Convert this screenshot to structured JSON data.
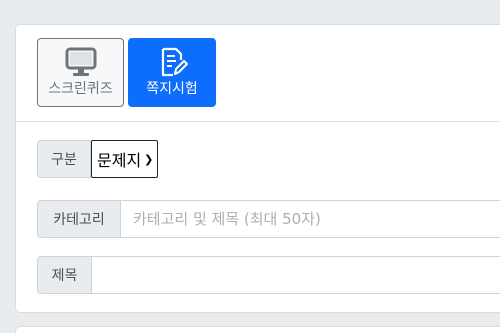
{
  "mode_buttons": {
    "quiz": {
      "label": "스크린퀴즈",
      "icon": "monitor-icon"
    },
    "test": {
      "label": "쪽지시험",
      "icon": "edit-document-icon",
      "active": true
    }
  },
  "form": {
    "type": {
      "label": "구분",
      "selected": "문제지"
    },
    "category": {
      "label": "카테고리",
      "placeholder": "카테고리 및 제목 (최대 50자)",
      "value": ""
    },
    "title": {
      "label": "제목",
      "value": ""
    }
  },
  "colors": {
    "primary": "#0d6efd",
    "secondary": "#6c757d",
    "addon_bg": "#e9ecef",
    "border": "#ced4da",
    "page_bg": "#e9ecef"
  }
}
